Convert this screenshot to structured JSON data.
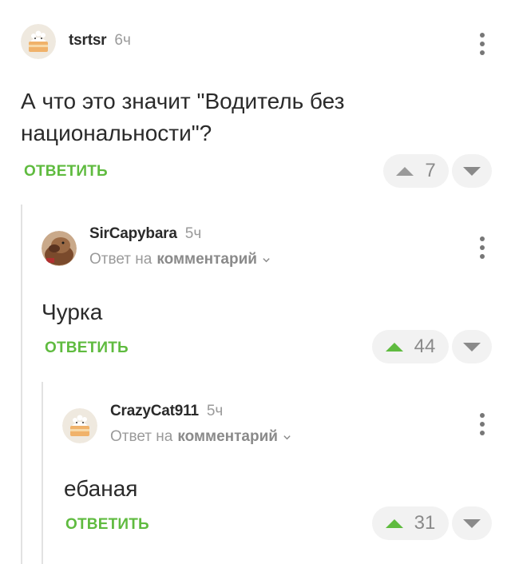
{
  "comments": [
    {
      "username": "tsrtsr",
      "time": "6ч",
      "text": "А что это значит \"Водитель без национальности\"?",
      "reply_label": "ОТВЕТИТЬ",
      "votes": "7",
      "avatar": "cat-cake-avatar",
      "upvoted": false
    },
    {
      "username": "SirCapybara",
      "time": "5ч",
      "reply_to_prefix": "Ответ на",
      "reply_to_target": "комментарий",
      "text": "Чурка",
      "reply_label": "ОТВЕТИТЬ",
      "votes": "44",
      "avatar": "capybara-avatar",
      "upvoted": true
    },
    {
      "username": "CrazyCat911",
      "time": "5ч",
      "reply_to_prefix": "Ответ на",
      "reply_to_target": "комментарий",
      "text": "ебаная",
      "reply_label": "ОТВЕТИТЬ",
      "votes": "31",
      "avatar": "cat-cake-avatar",
      "upvoted": true
    }
  ],
  "colors": {
    "accent_green": "#5fbb3f",
    "muted_gray": "#9a9a9a",
    "button_bg": "#f2f2f2"
  }
}
